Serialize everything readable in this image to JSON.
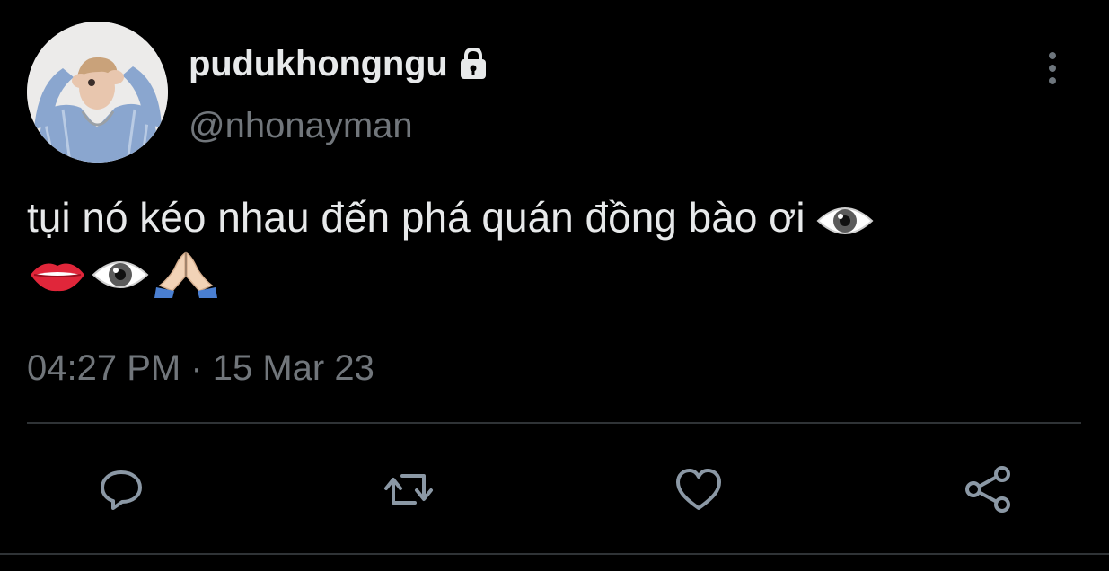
{
  "tweet": {
    "display_name": "pudukhongngu",
    "handle": "@nhonayman",
    "text": "tụi nó kéo nhau đến phá quán đồng bào ơi",
    "emojis_line1": [
      "eye"
    ],
    "emojis_line2": [
      "lips",
      "eye",
      "folded-hands"
    ],
    "timestamp": "04:27 PM · 15 Mar 23",
    "protected": true
  },
  "actions": [
    {
      "name": "reply",
      "icon": "reply-icon"
    },
    {
      "name": "retweet",
      "icon": "retweet-icon"
    },
    {
      "name": "like",
      "icon": "heart-icon"
    },
    {
      "name": "share",
      "icon": "share-icon"
    }
  ],
  "colors": {
    "background": "#000000",
    "primary_text": "#e7e9ea",
    "secondary_text": "#71767b",
    "divider": "#2f3336",
    "icon": "#8b98a5"
  }
}
